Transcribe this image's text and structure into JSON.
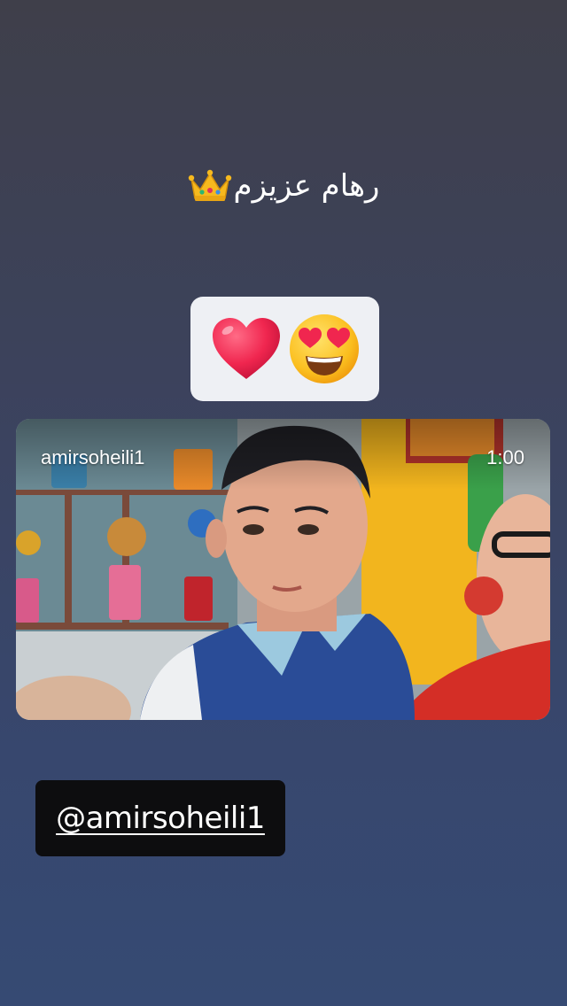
{
  "story": {
    "caption": {
      "text": "رهام عزیزم",
      "emoji_icon": "crown-emoji"
    },
    "reaction_sticker": {
      "emojis": [
        "red-heart-emoji",
        "heart-eyes-emoji"
      ]
    },
    "video_post": {
      "username": "amirsoheili1",
      "duration": "1:00"
    },
    "mention": {
      "text": "@amirsoheili1"
    }
  },
  "colors": {
    "background_top": "#3f3f4a",
    "background_bottom": "#364a73",
    "sticker_bg": "#eef0f4",
    "mention_bg": "#0d0d0f"
  }
}
